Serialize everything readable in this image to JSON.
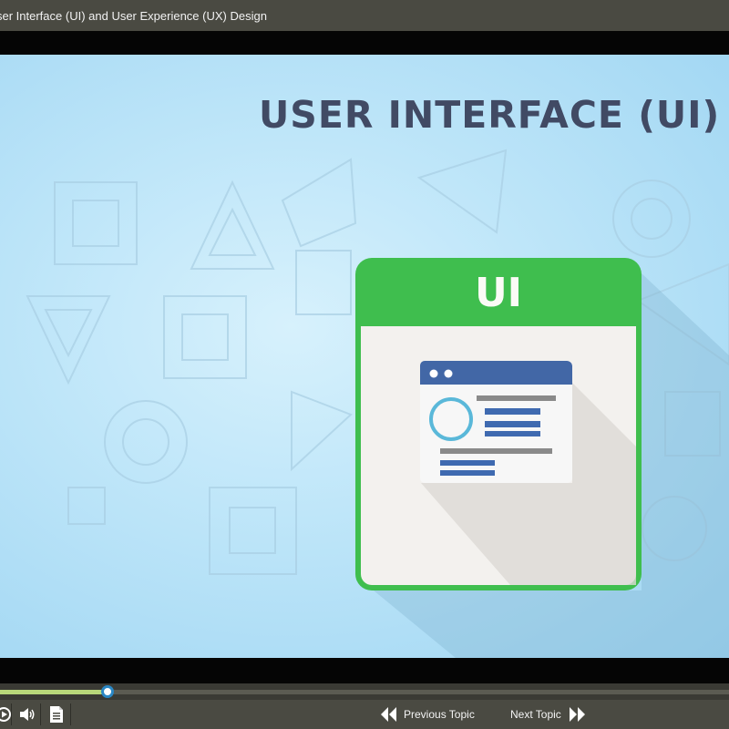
{
  "window": {
    "title": "ser Interface (UI) and User Experience (UX) Design"
  },
  "slide": {
    "heading": "USER INTERFACE (UI)",
    "card_label": "UI"
  },
  "playback": {
    "progress_fraction": 0.148
  },
  "controls": {
    "replay_icon": "replay-icon",
    "volume_icon": "volume-icon",
    "transcript_icon": "document-icon",
    "previous_label": "Previous Topic",
    "next_label": "Next Topic"
  },
  "colors": {
    "accent_green": "#3fbe4e",
    "heading_text": "#414a64",
    "browser_blue": "#4267a6",
    "ring_cyan": "#5ab8d9",
    "progress_fill": "#b8d77a",
    "knob_border": "#2a87c4"
  }
}
